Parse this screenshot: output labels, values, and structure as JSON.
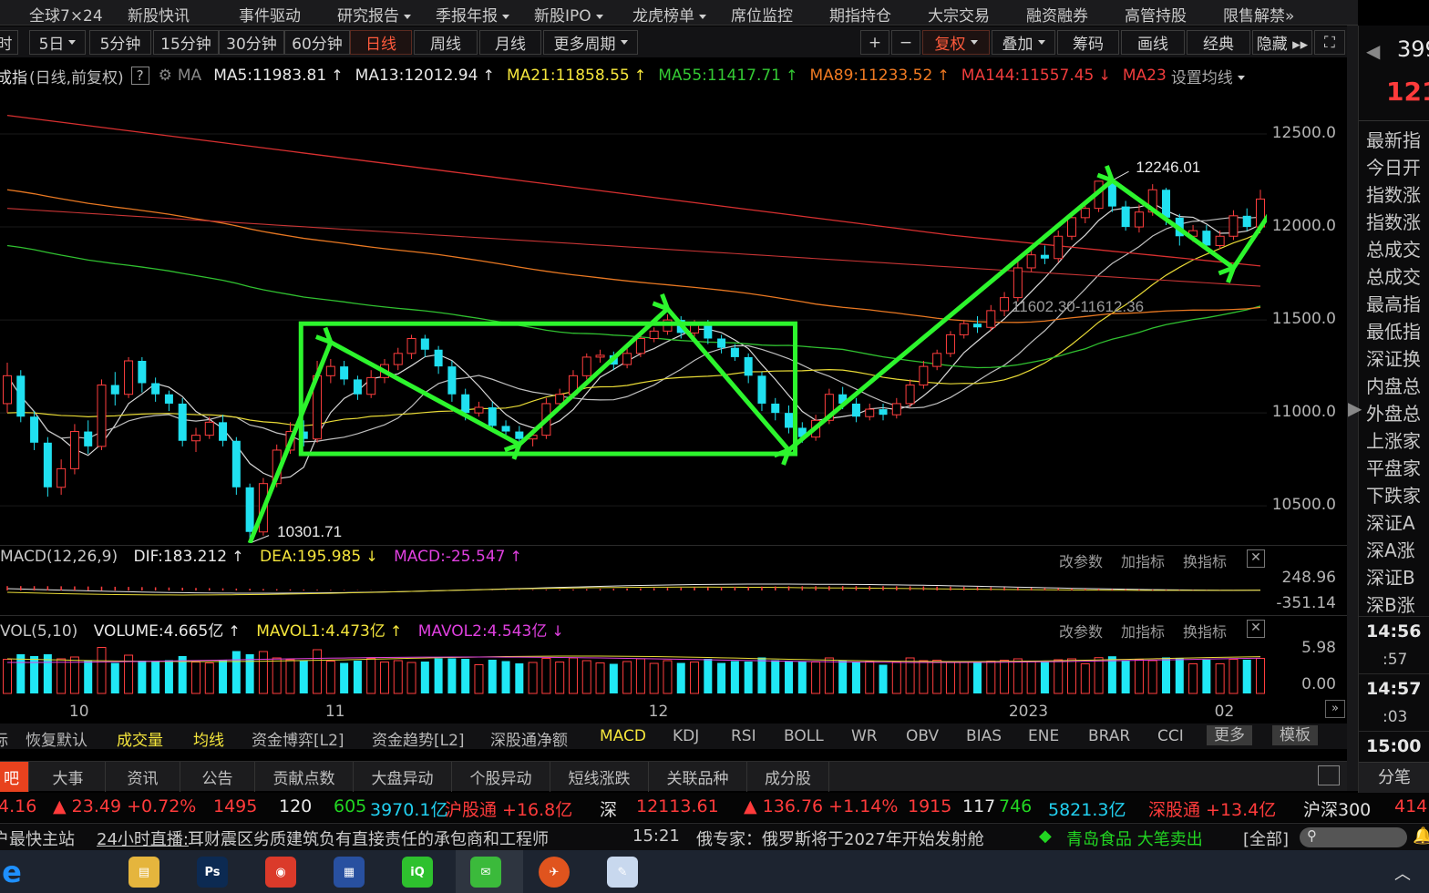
{
  "top_menu": [
    "全球7×24",
    "新股快讯",
    "事件驱动",
    "研究报告",
    "季报年报",
    "新股IPO",
    "龙虎榜单",
    "席位监控",
    "期指持仓",
    "大宗交易",
    "融资融券",
    "高管持股",
    "限售解禁»"
  ],
  "period_bar": {
    "buttons": [
      "时",
      "5日",
      "5分钟",
      "15分钟",
      "30分钟",
      "60分钟",
      "日线",
      "周线",
      "月线",
      "更多周期"
    ],
    "active": "日线",
    "tools": [
      "+",
      "−",
      "复权",
      "叠加",
      "筹码",
      "画线",
      "经典",
      "隐藏 ▸▸",
      "⛶"
    ]
  },
  "ma_line": {
    "title": "成指",
    "subtitle": "(日线,前复权)",
    "help": "?",
    "gear": "gear-icon",
    "ma_label": "MA",
    "items": [
      {
        "text": "MA5:11983.81",
        "dir": "up",
        "color": "#e8e8e8"
      },
      {
        "text": "MA13:12012.94",
        "dir": "up",
        "color": "#e8e8e8"
      },
      {
        "text": "MA21:11858.55",
        "dir": "up",
        "color": "#f5e63c"
      },
      {
        "text": "MA55:11417.71",
        "dir": "up",
        "color": "#34c934"
      },
      {
        "text": "MA89:11233.52",
        "dir": "up",
        "color": "#f07a22"
      },
      {
        "text": "MA144:11557.45",
        "dir": "dn",
        "color": "#f03c3c"
      },
      {
        "text": "MA23",
        "dir": "",
        "color": "#f03c3c"
      }
    ],
    "settings": "设置均线"
  },
  "chart_data": {
    "type": "candlestick",
    "title": "成指",
    "y_axis_ticks": [
      12500,
      12000,
      11500,
      11000,
      10500
    ],
    "y_axis_labels": [
      "12500.0",
      "12000.0",
      "11500.0",
      "11000.0",
      "10500.0"
    ],
    "ylim": [
      10300,
      12750
    ],
    "x_tick_labels": [
      "10",
      "11",
      "12",
      "2023",
      "02"
    ],
    "high_label": "12246.01",
    "low_label": "10301.71",
    "range_label": "11602.30-11612.36",
    "candles": [
      [
        11050,
        11200,
        11270,
        11000
      ],
      [
        11200,
        10980,
        11230,
        10950
      ],
      [
        10980,
        10840,
        11010,
        10800
      ],
      [
        10840,
        10600,
        10870,
        10550
      ],
      [
        10600,
        10700,
        10750,
        10560
      ],
      [
        10700,
        10900,
        10940,
        10670
      ],
      [
        10900,
        10820,
        10960,
        10780
      ],
      [
        10820,
        11150,
        11180,
        10800
      ],
      [
        11150,
        11100,
        11220,
        11040
      ],
      [
        11100,
        11280,
        11300,
        11080
      ],
      [
        11280,
        11160,
        11300,
        11110
      ],
      [
        11160,
        11100,
        11190,
        11060
      ],
      [
        11100,
        11050,
        11120,
        11010
      ],
      [
        11050,
        10850,
        11080,
        10820
      ],
      [
        10850,
        10880,
        10920,
        10790
      ],
      [
        10880,
        10950,
        10980,
        10860
      ],
      [
        10950,
        10850,
        10990,
        10820
      ],
      [
        10850,
        10600,
        10870,
        10560
      ],
      [
        10600,
        10360,
        10620,
        10300
      ],
      [
        10360,
        10620,
        10650,
        10340
      ],
      [
        10620,
        10800,
        10830,
        10600
      ],
      [
        10800,
        10900,
        10950,
        10780
      ],
      [
        10900,
        10860,
        10960,
        10820
      ],
      [
        10860,
        11200,
        11280,
        10840
      ],
      [
        11200,
        11250,
        11290,
        11160
      ],
      [
        11250,
        11180,
        11280,
        11150
      ],
      [
        11180,
        11100,
        11200,
        11070
      ],
      [
        11100,
        11190,
        11230,
        11080
      ],
      [
        11190,
        11260,
        11290,
        11160
      ],
      [
        11260,
        11320,
        11350,
        11230
      ],
      [
        11320,
        11400,
        11420,
        11290
      ],
      [
        11400,
        11340,
        11420,
        11300
      ],
      [
        11340,
        11250,
        11360,
        11210
      ],
      [
        11250,
        11100,
        11280,
        11060
      ],
      [
        11100,
        11000,
        11130,
        10960
      ],
      [
        11000,
        11030,
        11060,
        10980
      ],
      [
        11030,
        10930,
        11060,
        10900
      ],
      [
        10930,
        10900,
        10960,
        10870
      ],
      [
        10900,
        10860,
        10930,
        10820
      ],
      [
        10860,
        10880,
        10900,
        10820
      ],
      [
        10880,
        11050,
        11080,
        10860
      ],
      [
        11050,
        11100,
        11130,
        11030
      ],
      [
        11100,
        11200,
        11230,
        11080
      ],
      [
        11200,
        11300,
        11320,
        11180
      ],
      [
        11300,
        11310,
        11340,
        11270
      ],
      [
        11310,
        11260,
        11330,
        11230
      ],
      [
        11260,
        11320,
        11350,
        11240
      ],
      [
        11320,
        11400,
        11430,
        11300
      ],
      [
        11400,
        11440,
        11460,
        11380
      ],
      [
        11440,
        11500,
        11530,
        11420
      ],
      [
        11500,
        11430,
        11520,
        11400
      ],
      [
        11430,
        11480,
        11500,
        11410
      ],
      [
        11480,
        11400,
        11500,
        11370
      ],
      [
        11400,
        11350,
        11420,
        11320
      ],
      [
        11350,
        11300,
        11370,
        11280
      ],
      [
        11300,
        11200,
        11320,
        11160
      ],
      [
        11200,
        11050,
        11220,
        11010
      ],
      [
        11050,
        11000,
        11080,
        10960
      ],
      [
        11000,
        10920,
        11040,
        10890
      ],
      [
        10920,
        10870,
        10950,
        10840
      ],
      [
        10870,
        10960,
        10990,
        10850
      ],
      [
        10960,
        11100,
        11130,
        10940
      ],
      [
        11100,
        11050,
        11140,
        11020
      ],
      [
        11050,
        10980,
        11080,
        10950
      ],
      [
        10980,
        11020,
        11050,
        10960
      ],
      [
        11020,
        10990,
        11050,
        10960
      ],
      [
        10990,
        11050,
        11080,
        10970
      ],
      [
        11050,
        11150,
        11180,
        11030
      ],
      [
        11150,
        11250,
        11280,
        11130
      ],
      [
        11250,
        11320,
        11340,
        11230
      ],
      [
        11320,
        11420,
        11440,
        11300
      ],
      [
        11420,
        11480,
        11500,
        11400
      ],
      [
        11480,
        11460,
        11520,
        11430
      ],
      [
        11460,
        11550,
        11580,
        11440
      ],
      [
        11550,
        11620,
        11650,
        11520
      ],
      [
        11620,
        11780,
        11820,
        11600
      ],
      [
        11780,
        11850,
        11880,
        11760
      ],
      [
        11850,
        11830,
        11900,
        11800
      ],
      [
        11830,
        11950,
        11980,
        11810
      ],
      [
        11950,
        12050,
        12080,
        11930
      ],
      [
        12050,
        12100,
        12130,
        12020
      ],
      [
        12100,
        12246,
        12246,
        12080
      ],
      [
        12246,
        12110,
        12250,
        12080
      ],
      [
        12110,
        12000,
        12140,
        11980
      ],
      [
        12000,
        12080,
        12120,
        11970
      ],
      [
        12080,
        12200,
        12230,
        12060
      ],
      [
        12200,
        12050,
        12210,
        12010
      ],
      [
        12050,
        11950,
        12070,
        11900
      ],
      [
        11950,
        11980,
        12010,
        11920
      ],
      [
        11980,
        11900,
        12010,
        11870
      ],
      [
        11900,
        11950,
        11980,
        11880
      ],
      [
        11950,
        12060,
        12090,
        11930
      ],
      [
        12060,
        12000,
        12100,
        11980
      ],
      [
        12000,
        12150,
        12200,
        11990
      ]
    ]
  },
  "macd": {
    "label": "MACD(12,26,9)",
    "dif": "DIF:183.212",
    "dea": "DEA:195.985",
    "macd": "MACD:-25.547",
    "axis_top": "248.96",
    "axis_bottom": "-351.14",
    "buttons": [
      "改参数",
      "加指标",
      "换指标"
    ]
  },
  "vol": {
    "label": "VOL(5,10)",
    "volume": "VOLUME:4.665亿",
    "mavol1": "MAVOL1:4.473亿",
    "mavol2": "MAVOL2:4.543亿",
    "axis_top": "5.98",
    "axis_bottom": "0.00",
    "buttons": [
      "改参数",
      "加指标",
      "换指标"
    ]
  },
  "indicator_bar": [
    "标",
    "恢复默认",
    "成交量",
    "均线",
    "资金博弈[L2]",
    "资金趋势[L2]",
    "深股通净额",
    "MACD",
    "KDJ",
    "RSI",
    "BOLL",
    "WR",
    "OBV",
    "BIAS",
    "ENE",
    "BRAR",
    "CCI",
    "更多",
    "模板"
  ],
  "tab_bar": [
    "吧",
    "大事",
    "资讯",
    "公告",
    "贡献点数",
    "大盘异动",
    "个股异动",
    "短线涨跌",
    "关联品种",
    "成分股"
  ],
  "right_tab": "分笔",
  "right_panel": {
    "code": "399",
    "price": "121",
    "labels": [
      "最新指",
      "今日开",
      "指数涨",
      "指数涨",
      "总成交",
      "总成交",
      "最高指",
      "最低指",
      "深证换",
      "内盘总",
      "外盘总",
      "上涨家",
      "平盘家",
      "下跌家",
      "深证A",
      "深A涨",
      "深证B",
      "深B涨"
    ],
    "times": [
      [
        "14:56",
        ":57"
      ],
      [
        "14:57",
        ":03"
      ],
      [
        "15:00",
        ""
      ]
    ]
  },
  "ticker1": [
    {
      "t": "4.16",
      "c": "#ff3b3b"
    },
    {
      "t": "▲ 23.49 +0.72%",
      "c": "#ff3b3b"
    },
    {
      "t": "1495",
      "c": "#ff3b3b"
    },
    {
      "t": "120",
      "c": "#e8e8e8"
    },
    {
      "t": "605",
      "c": "#22d622"
    },
    {
      "t": "3970.1亿",
      "c": "#22d0f0"
    },
    {
      "t": "沪股通 +16.8亿",
      "c": "#ff3b3b"
    },
    {
      "t": "深",
      "c": "#e0e0e0"
    },
    {
      "t": "12113.61",
      "c": "#ff3b3b"
    },
    {
      "t": "▲ 136.76 +1.14%",
      "c": "#ff3b3b"
    },
    {
      "t": "1915",
      "c": "#ff3b3b"
    },
    {
      "t": "117",
      "c": "#e8e8e8"
    },
    {
      "t": "746",
      "c": "#22d622"
    },
    {
      "t": "5821.3亿",
      "c": "#22d0f0"
    },
    {
      "t": "深股通 +13.4亿",
      "c": "#ff3b3b"
    },
    {
      "t": "沪深300",
      "c": "#e0e0e0"
    },
    {
      "t": "414",
      "c": "#ff3b3b"
    }
  ],
  "ticker2": {
    "left": "户最快主站",
    "live": "24小时直播:",
    "news1": "耳财震区劣质建筑负有直接责任的承包商和工程师",
    "time": "15:21",
    "news2": "俄专家：俄罗斯将于2027年开始发射舱",
    "alert": "青岛食品 大笔卖出",
    "scope": "[全部]"
  },
  "taskbar": [
    "edge",
    "explorer",
    "photoshop",
    "chrome",
    "app",
    "iqiyi",
    "wechat",
    "tonghuashun",
    "paint"
  ]
}
